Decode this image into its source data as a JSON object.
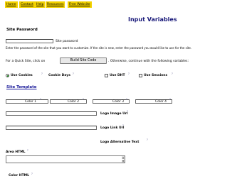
{
  "nav": {
    "items": [
      "Home",
      "Contact",
      "Help",
      "Resources",
      "Free Website"
    ]
  },
  "page_title": "Input Variables",
  "site_password": {
    "heading": "Site Password",
    "field_label": "Site password",
    "value": "",
    "description": "Enter the password of the site that you want to customize. If the site is new, enter the password you would like to use for the site."
  },
  "quick_build": {
    "intro": "For a Quick Site, click on",
    "button_label": "Build Site Code",
    "outro": ". Otherwise, continue with the following variables:"
  },
  "options": {
    "use_cookies": "Use Cookies",
    "cookie_days_label": "Cookie Days",
    "use_dhtml": "Use DHT",
    "use_sessions": "Use Sessions"
  },
  "site_template": {
    "heading": "Site Template",
    "colors": [
      "Color 1",
      "Color 2",
      "Color 3",
      "Color 4"
    ],
    "logo_image_url": "Logo Image Url",
    "logo_link_url": "Logo Link Url",
    "logo_alt_text": "Logo Alternative Text",
    "area_html": "Area HTML",
    "color_html": "Color HTML"
  },
  "help_marker": "?"
}
